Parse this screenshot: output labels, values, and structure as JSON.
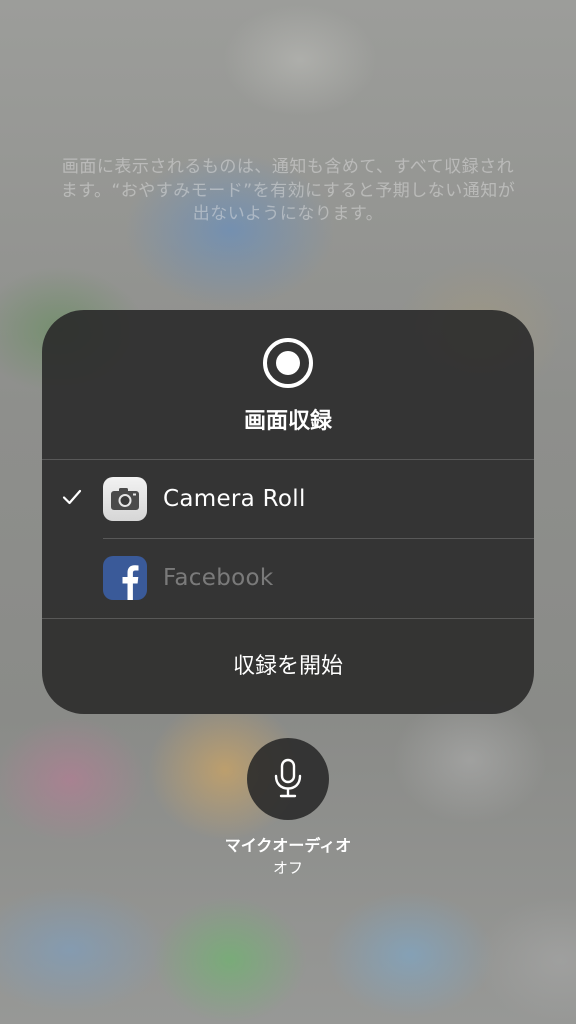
{
  "notice_text": "画面に表示されるものは、通知も含めて、すべて収録されます。“おやすみモード”を有効にすると予期しない通知が出ないようになります。",
  "panel": {
    "record_icon": "record-icon",
    "title": "画面収録",
    "destinations": [
      {
        "label": "Camera Roll",
        "icon": "camera-icon",
        "selected": true
      },
      {
        "label": "Facebook",
        "icon": "facebook-icon",
        "selected": false
      }
    ],
    "start_label": "収録を開始"
  },
  "mic": {
    "icon": "microphone-icon",
    "label": "マイクオーディオ",
    "status": "オフ"
  }
}
